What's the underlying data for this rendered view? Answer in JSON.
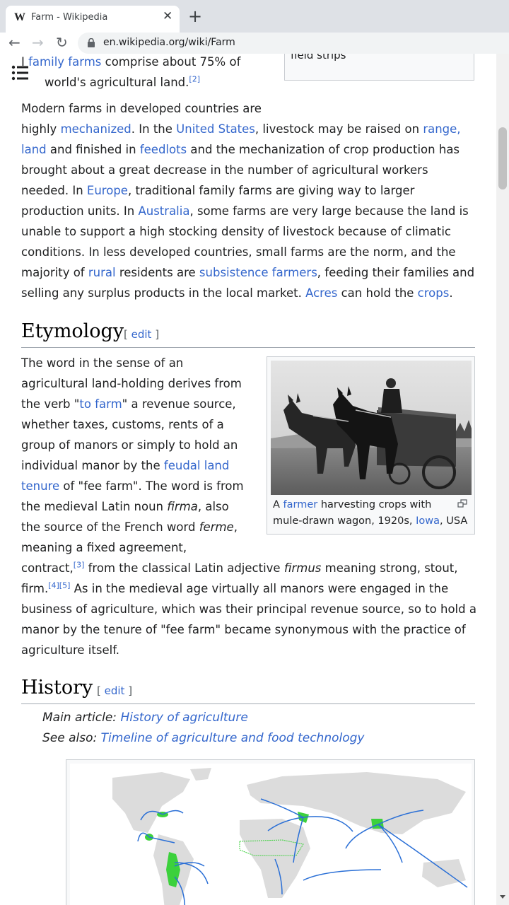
{
  "browser": {
    "tab_title": "Farm - Wikipedia",
    "tab_favicon": "W",
    "url": "en.wikipedia.org/wiki/Farm"
  },
  "fragment": {
    "line1_prefix": "I ",
    "line1_link": "family farms",
    "line1_suffix": " comprise about 75% of",
    "line2_text": "world's agricultural land.",
    "line2_ref": "[2]"
  },
  "top_thumb": {
    "caption_tail": "field strips"
  },
  "modern": {
    "l1": "Modern farms in developed countries are",
    "l2a": "highly ",
    "l2_link1": "mechanized",
    "l2b": ". In the ",
    "l2_link2": "United States",
    "l2c": ", livestock may be raised on ",
    "l2_link3": "range,",
    "l3_link1": "land",
    "l3a": " and finished in ",
    "l3_link2": "feedlots",
    "l3b": " and the mechanization of crop production has",
    "l4": "brought about a great decrease in the number of agricultural workers",
    "l5a": "needed. In ",
    "l5_link": "Europe",
    "l5b": ", traditional family farms are giving way to larger",
    "l6a": "production units. In ",
    "l6_link": "Australia",
    "l6b": ", some farms are very large because the land is",
    "l7": "unable to support a high stocking density of livestock because of climatic",
    "l8": "conditions. In less developed countries, small farms are the norm, and the",
    "l9a": "majority of ",
    "l9_link1": "rural",
    "l9b": " residents are ",
    "l9_link2": "subsistence farmers",
    "l9c": ", feeding their families and",
    "l10a": "selling any surplus products in the local market. ",
    "l10_link1": "Acres",
    "l10b": " can hold the ",
    "l10_link2": "crops",
    "l10c": "."
  },
  "etymology": {
    "heading": "Etymology",
    "edit_open": "[ ",
    "edit_label": "edit",
    "edit_close": " ]",
    "l1": "The word in the sense of an",
    "l2": "agricultural land-holding derives from",
    "l3a": "the verb \"",
    "l3_link": "to farm",
    "l3b": "\" a revenue source,",
    "l4": "whether taxes, customs, rents of a",
    "l5": "group of manors or simply to hold an",
    "l6a": "individual manor by the ",
    "l6_link": "feudal land",
    "l7_link": "tenure",
    "l7b": " of \"fee farm\". The word is from",
    "l8a": "the medieval Latin noun ",
    "l8_i": "firma",
    "l8b": ", also",
    "l9a": "the source of the French word ",
    "l9_i": "ferme",
    "l9b": ",",
    "l10": "meaning a fixed agreement,",
    "l11a": "contract,",
    "l11_ref": "[3]",
    "l11b": " from the classical Latin adjective ",
    "l11_i": "firmus",
    "l11c": " meaning strong, stout,",
    "l12a": "firm.",
    "l12_ref": "[4][5]",
    "l12b": " As in the medieval age virtually all manors were engaged in the",
    "l13": "business of agriculture, which was their principal revenue source, so to hold a",
    "l14": "manor by the tenure of \"fee farm\" became synonymous with the practice of",
    "l15": "agriculture itself.",
    "thumb_caption_a": "A ",
    "thumb_caption_link1": "farmer",
    "thumb_caption_b": " harvesting crops with",
    "thumb_caption_c": "mule-drawn wagon, 1920s, ",
    "thumb_caption_link2": "Iowa",
    "thumb_caption_d": ", USA"
  },
  "history": {
    "heading": "History",
    "edit_open": "[ ",
    "edit_label": "edit",
    "edit_close": " ]",
    "main_prefix": "Main article: ",
    "main_link": "History of agriculture",
    "see_prefix": "See also: ",
    "see_link": "Timeline of agriculture and food technology"
  },
  "icons": [
    "wikipedia-favicon",
    "close-icon",
    "plus-icon",
    "back-arrow-icon",
    "forward-arrow-icon",
    "reload-icon",
    "lock-icon",
    "toc-list-icon",
    "magnify-icon"
  ],
  "colors": {
    "link": "#3366cc",
    "text": "#202122",
    "map_origin_green": "#3cd13c",
    "map_arrow_blue": "#2a6fd6"
  }
}
